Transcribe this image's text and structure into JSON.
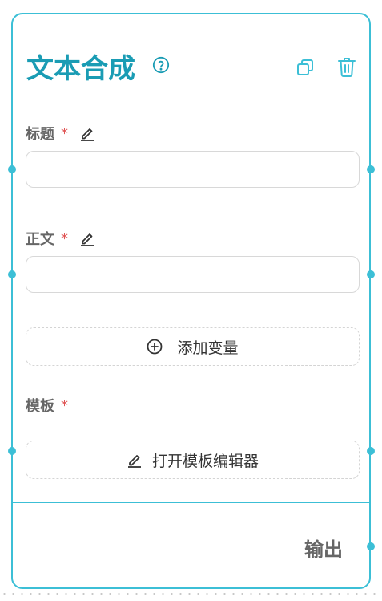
{
  "node": {
    "title": "文本合成",
    "icons": {
      "help": "help-circle-icon",
      "copy": "copy-icon",
      "delete": "trash-icon"
    }
  },
  "fields": {
    "title_label": "标题",
    "body_label": "正文",
    "required_mark": "*",
    "title_value": "",
    "body_value": ""
  },
  "add_variable": {
    "label": "添加变量"
  },
  "template": {
    "label": "模板",
    "open_editor_label": "打开模板编辑器"
  },
  "output": {
    "label": "输出"
  },
  "colors": {
    "accent": "#3cbfd6",
    "title": "#1a9cb4",
    "required": "#e05555",
    "label": "#666666"
  }
}
